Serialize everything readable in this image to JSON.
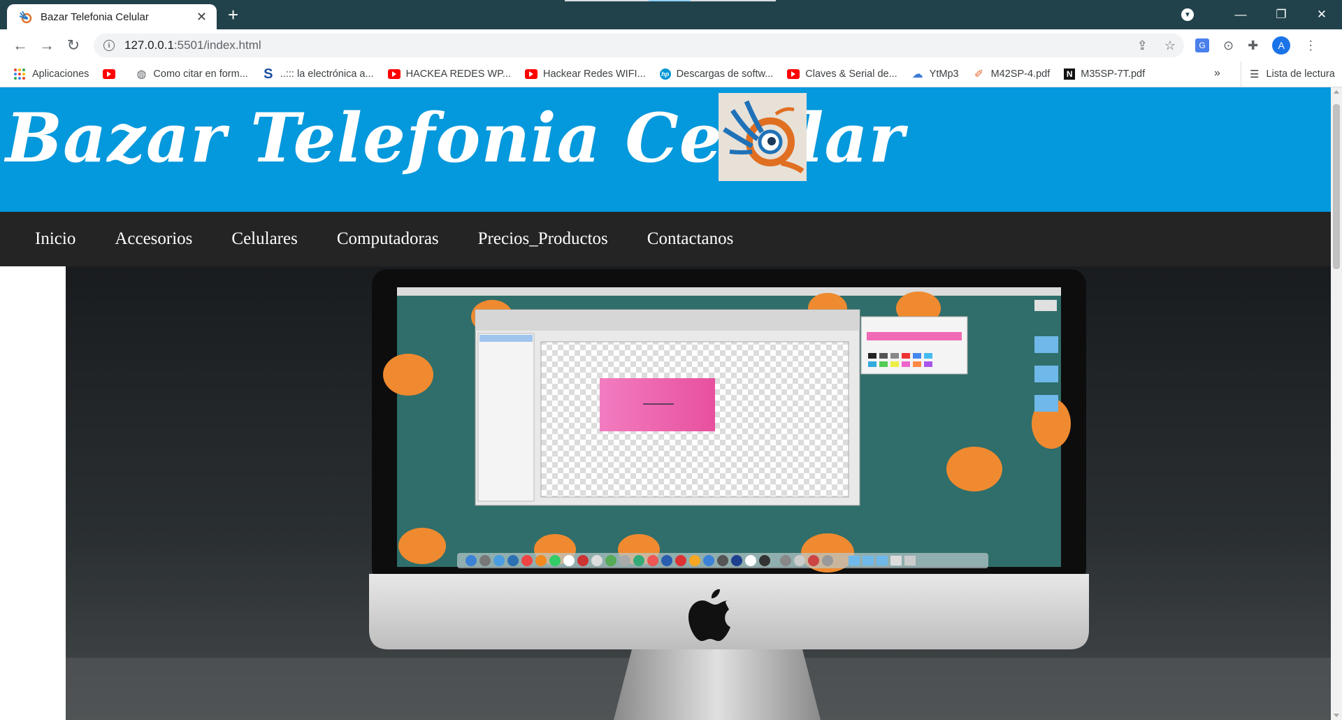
{
  "browser": {
    "tab_title": "Bazar Telefonia Celular",
    "url_host": "127.0.0.1",
    "url_rest": ":5501/index.html",
    "bookmarks": [
      {
        "label": "Aplicaciones",
        "icon": "apps-grid-icon"
      },
      {
        "label": "",
        "icon": "youtube-icon"
      },
      {
        "label": "Como citar en form...",
        "icon": "globe-icon"
      },
      {
        "label": "..::: la electrónica a...",
        "icon": "s-logo-icon"
      },
      {
        "label": "HACKEA REDES WP...",
        "icon": "youtube-icon"
      },
      {
        "label": "Hackear Redes WIFI...",
        "icon": "youtube-icon"
      },
      {
        "label": "Descargas de softw...",
        "icon": "hp-icon"
      },
      {
        "label": "Claves & Serial de...",
        "icon": "youtube-icon"
      },
      {
        "label": "YtMp3",
        "icon": "cloud-download-icon"
      },
      {
        "label": "M42SP-4.pdf",
        "icon": "pdf-icon"
      },
      {
        "label": "M35SP-7T.pdf",
        "icon": "n-logo-icon"
      }
    ],
    "more_bookmarks": "»",
    "reading_list": "Lista de lectura",
    "avatar_letter": "A"
  },
  "site": {
    "title": "Bazar Telefonia Celular",
    "nav": [
      "Inicio",
      "Accesorios",
      "Celulares",
      "Computadoras",
      "Precios_Productos",
      "Contactanos"
    ]
  },
  "colors": {
    "header_bg": "#0498dc",
    "nav_bg": "#242424",
    "chrome_bg": "#21414b"
  }
}
